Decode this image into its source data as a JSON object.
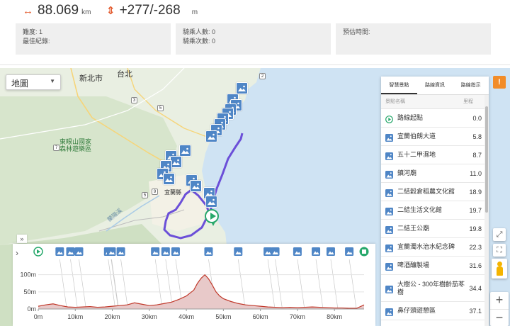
{
  "stats": {
    "distance": "88.069",
    "distance_unit": "km",
    "elevation": "+277/-268",
    "elevation_unit": "m",
    "difficulty": "難度: 1",
    "best_record": "最佳紀錄:",
    "riders": "騎乘人數: 0",
    "rides": "騎乘次數: 0",
    "est_time": "預估時間:"
  },
  "map": {
    "type_selector": "地圖",
    "places": {
      "newtaipei": "新北市",
      "taipei": "台北",
      "dongyan": "東眼山國家",
      "dongyan2": "森林遊樂區",
      "yilan": "宜蘭縣",
      "river": "蘭陽溪"
    },
    "route_color": "#6b4fd8",
    "pin_color": "#4f86c6",
    "warn_label": "!"
  },
  "panel": {
    "tabs": [
      "智慧景點",
      "路線資訊",
      "路線指示"
    ],
    "col_name": "景點名稱",
    "col_km": "里程",
    "rows": [
      {
        "name": "路線起點",
        "km": "0.0",
        "icon": "start-icon"
      },
      {
        "name": "宜蘭伯朗大道",
        "km": "5.8",
        "icon": "photo-icon"
      },
      {
        "name": "五十二甲濕地",
        "km": "8.7",
        "icon": "photo-icon"
      },
      {
        "name": "鎮河廟",
        "km": "11.0",
        "icon": "photo-icon"
      },
      {
        "name": "二結穀倉稻農文化館",
        "km": "18.9",
        "icon": "photo-icon"
      },
      {
        "name": "二結生活文化館",
        "km": "19.7",
        "icon": "photo-icon"
      },
      {
        "name": "二結王公廟",
        "km": "19.8",
        "icon": "photo-icon"
      },
      {
        "name": "宜蘭濁水治水紀念碑",
        "km": "22.3",
        "icon": "photo-icon"
      },
      {
        "name": "啤酒釀製場",
        "km": "31.6",
        "icon": "photo-icon"
      },
      {
        "name": "大樹公 - 300年樹齡茄苳樹",
        "km": "34.4",
        "icon": "photo-icon"
      },
      {
        "name": "鼻仔頭遊憩區",
        "km": "37.1",
        "icon": "photo-icon"
      }
    ]
  },
  "chart_data": {
    "type": "area",
    "xlabel": "",
    "ylabel": "",
    "x_ticks": [
      "0m",
      "10km",
      "20km",
      "30km",
      "40km",
      "50km",
      "60km",
      "70km",
      "80km"
    ],
    "y_ticks": [
      "0m",
      "50m",
      "100m"
    ],
    "xlim": [
      0,
      88
    ],
    "ylim": [
      0,
      120
    ],
    "x": [
      0,
      2,
      4,
      6,
      8,
      10,
      12,
      14,
      16,
      18,
      20,
      22,
      24,
      26,
      28,
      30,
      32,
      34,
      36,
      38,
      40,
      42,
      43,
      44,
      45,
      46,
      47,
      48,
      49,
      50,
      52,
      54,
      56,
      58,
      60,
      62,
      64,
      66,
      68,
      70,
      72,
      74,
      76,
      78,
      80,
      82,
      84,
      86,
      88
    ],
    "values": [
      8,
      12,
      15,
      10,
      6,
      5,
      6,
      7,
      5,
      6,
      8,
      10,
      12,
      18,
      14,
      10,
      12,
      16,
      20,
      28,
      38,
      55,
      75,
      90,
      100,
      88,
      70,
      50,
      38,
      30,
      22,
      16,
      12,
      10,
      8,
      6,
      5,
      4,
      5,
      4,
      5,
      6,
      5,
      4,
      3,
      3,
      2,
      2,
      12
    ],
    "fill": "#e8c9c9",
    "stroke": "#c0392b",
    "marker_km": [
      0,
      5.8,
      8.7,
      11.0,
      18.9,
      19.7,
      19.8,
      22.3,
      31.6,
      34.4,
      37.1,
      46,
      54,
      62,
      64,
      70,
      75,
      79,
      84,
      88
    ]
  }
}
